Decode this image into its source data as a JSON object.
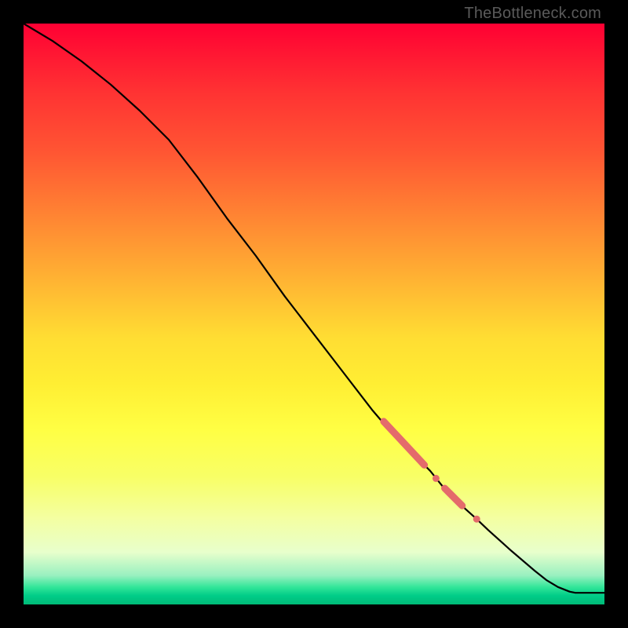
{
  "watermark": "TheBottleneck.com",
  "colors": {
    "line": "#000000",
    "marker": "#e46b6b",
    "bg_top": "#ff0033",
    "bg_bottom": "#00bb77"
  },
  "chart_data": {
    "type": "line",
    "title": "",
    "xlabel": "",
    "ylabel": "",
    "xlim": [
      0,
      100
    ],
    "ylim": [
      0,
      100
    ],
    "grid": false,
    "legend": false,
    "series": [
      {
        "name": "curve",
        "x": [
          0,
          5,
          10,
          15,
          20,
          25,
          30,
          35,
          40,
          45,
          50,
          55,
          60,
          63,
          66,
          69,
          70,
          72,
          74,
          76,
          78,
          80,
          82,
          84,
          86,
          88,
          90,
          92,
          94,
          95,
          100
        ],
        "y": [
          100,
          97,
          93.5,
          89.5,
          85,
          80,
          73.5,
          66.5,
          60,
          53,
          46.5,
          40,
          33.5,
          30,
          27,
          24,
          23,
          20.5,
          18.5,
          16.5,
          14.7,
          12.8,
          11,
          9.2,
          7.5,
          5.8,
          4.2,
          3,
          2.2,
          2,
          2
        ]
      }
    ],
    "markers": [
      {
        "shape": "segment",
        "x1": 62,
        "y1": 31.5,
        "x2": 69,
        "y2": 24.0,
        "width": 9
      },
      {
        "shape": "dot",
        "x": 71,
        "y": 21.7,
        "r": 4.5
      },
      {
        "shape": "segment",
        "x1": 72.5,
        "y1": 20.0,
        "x2": 75.5,
        "y2": 17.0,
        "width": 9
      },
      {
        "shape": "dot",
        "x": 78,
        "y": 14.7,
        "r": 4.5
      }
    ]
  }
}
